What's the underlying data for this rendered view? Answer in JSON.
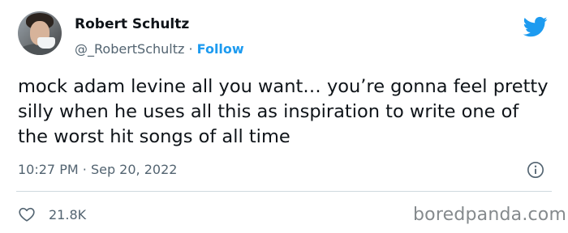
{
  "author": {
    "name": "Robert Schultz",
    "handle": "@_RobertSchultz",
    "separator": "·",
    "follow_label": "Follow"
  },
  "tweet": {
    "text": "mock adam levine all you want… you’re gonna feel pretty silly when he uses all this as inspiration to write one of the worst hit songs of all time",
    "time": "10:27 PM",
    "date_separator": "·",
    "date": "Sep 20, 2022"
  },
  "stats": {
    "likes": "21.8K"
  },
  "watermark": "boredpanda.com",
  "icons": {
    "brand": "twitter-bird-icon",
    "info": "info-icon",
    "like": "heart-icon"
  },
  "colors": {
    "accent": "#1d9bf0",
    "text": "#0f1419",
    "secondary": "#536471",
    "divider": "#cfd9de",
    "watermark": "#858a8d"
  }
}
